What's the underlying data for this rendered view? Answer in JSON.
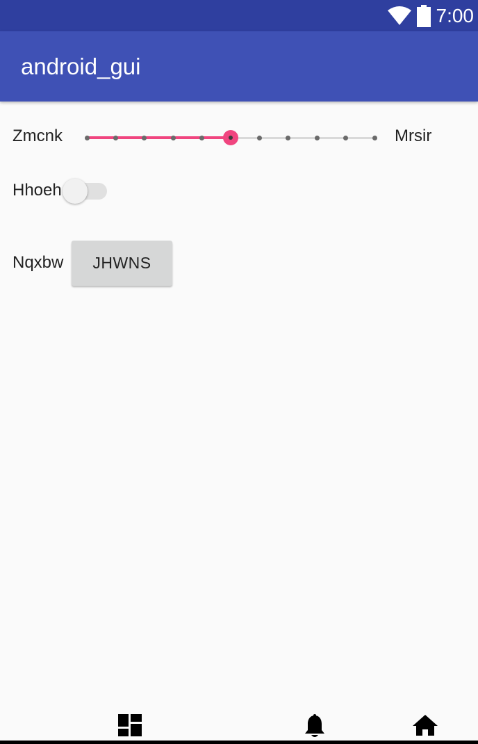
{
  "status_bar": {
    "time": "7:00",
    "icons": [
      "wifi-icon",
      "battery-icon"
    ],
    "background": "#2f3f9f"
  },
  "app_bar": {
    "title": "android_gui",
    "background": "#3f51b5"
  },
  "content": {
    "slider_row": {
      "start_label": "Zmcnk",
      "end_label": "Mrsir",
      "slider": {
        "min": 0,
        "max": 10,
        "value": 5,
        "accent": "#f0457f"
      }
    },
    "switch_row": {
      "label": "Hhoeh",
      "switch_on": false
    },
    "button_row": {
      "label": "Nqxbw",
      "button_label": "JHWNS"
    }
  },
  "bottom_bar": {
    "icons": [
      "dashboard-icon",
      "bell-icon",
      "home-icon"
    ]
  }
}
